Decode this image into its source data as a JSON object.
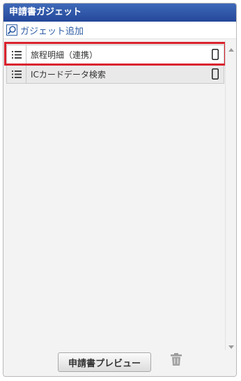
{
  "panel": {
    "title": "申請書ガジェット",
    "add_gadget_label": "ガジェット追加"
  },
  "gadgets": [
    {
      "label": "旅程明細（連携）",
      "highlighted": true
    },
    {
      "label": "ICカードデータ検索",
      "highlighted": false
    }
  ],
  "footer": {
    "preview_button": "申請書プレビュー"
  },
  "colors": {
    "header": "#2c50a2",
    "link": "#2f5ea5",
    "highlight_border": "#d9222d"
  },
  "icons": {
    "add": "search-add-icon",
    "handle": "list-handle-icon",
    "device": "smartphone-icon",
    "delete": "trash-icon"
  }
}
